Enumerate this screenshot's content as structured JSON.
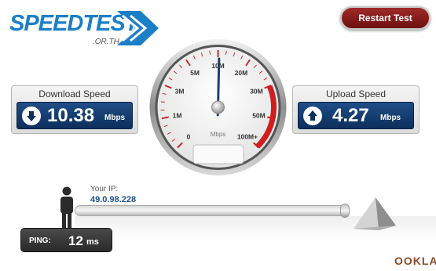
{
  "logo": {
    "title": "SPEEDTEST",
    "domain": ".OR.TH"
  },
  "restart_label": "Restart Test",
  "download": {
    "label": "Download Speed",
    "value": "10.38",
    "unit": "Mbps",
    "icon": "arrow-down-icon"
  },
  "upload": {
    "label": "Upload Speed",
    "value": "4.27",
    "unit": "Mbps",
    "icon": "arrow-up-icon"
  },
  "gauge": {
    "scale": [
      "0",
      "1M",
      "3M",
      "5M",
      "10M",
      "20M",
      "30M",
      "50M",
      "100M+"
    ],
    "unit": "Mbps",
    "needle_value_mbps": 10.38
  },
  "ip": {
    "label": "Your IP:",
    "value": "49.0.98.228"
  },
  "ping": {
    "label": "PING:",
    "value": "12",
    "unit": "ms"
  },
  "brand": "OOKLA",
  "colors": {
    "accent": "#1b7fc8",
    "panel_bg": "#0d2f5c",
    "danger": "#d01e1e",
    "restart": "#8a1a1a"
  }
}
